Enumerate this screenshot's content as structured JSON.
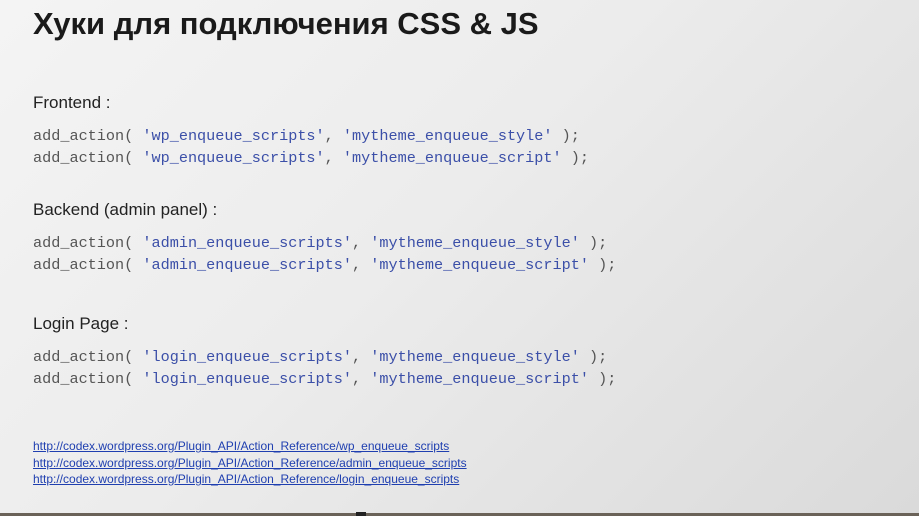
{
  "slide": {
    "title": "Хуки для подключения CSS & JS",
    "sections": [
      {
        "heading": "Frontend :",
        "lines": [
          {
            "func": "add_action( ",
            "hook": "'wp_enqueue_scripts'",
            "sep": ", ",
            "callback": "'mytheme_enqueue_style'",
            "end": " );"
          },
          {
            "func": "add_action( ",
            "hook": "'wp_enqueue_scripts'",
            "sep": ", ",
            "callback": "'mytheme_enqueue_script'",
            "end": " );"
          }
        ]
      },
      {
        "heading": "Backend (admin panel) :",
        "lines": [
          {
            "func": "add_action( ",
            "hook": "'admin_enqueue_scripts'",
            "sep": ", ",
            "callback": "'mytheme_enqueue_style'",
            "end": " );"
          },
          {
            "func": "add_action( ",
            "hook": "'admin_enqueue_scripts'",
            "sep": ", ",
            "callback": "'mytheme_enqueue_script'",
            "end": " );"
          }
        ]
      },
      {
        "heading": "Login Page :",
        "lines": [
          {
            "func": "add_action( ",
            "hook": "'login_enqueue_scripts'",
            "sep": ", ",
            "callback": "'mytheme_enqueue_style'",
            "end": " );"
          },
          {
            "func": "add_action( ",
            "hook": "'login_enqueue_scripts'",
            "sep": ", ",
            "callback": "'mytheme_enqueue_script'",
            "end": " );"
          }
        ]
      }
    ],
    "links": [
      "http://codex.wordpress.org/Plugin_API/Action_Reference/wp_enqueue_scripts",
      "http://codex.wordpress.org/Plugin_API/Action_Reference/admin_enqueue_scripts",
      "http://codex.wordpress.org/Plugin_API/Action_Reference/login_enqueue_scripts"
    ],
    "colors": {
      "code_text": "#555555",
      "code_string": "#3b4fa8",
      "link": "#1f3fb0"
    }
  }
}
